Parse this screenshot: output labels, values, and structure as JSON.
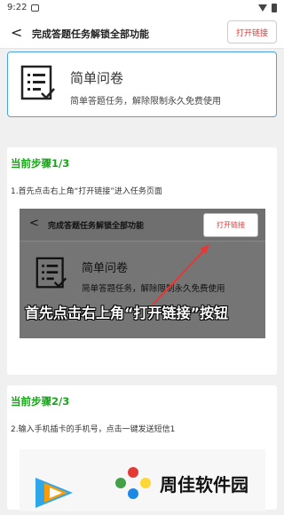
{
  "status_bar": {
    "time": "9:22"
  },
  "header": {
    "back_label": "<",
    "title": "完成答题任务解锁全部功能",
    "open_link_label": "打开链接"
  },
  "survey": {
    "name": "简单问卷",
    "description": "简单答题任务，解除限制永久免费使用"
  },
  "steps": [
    {
      "title": "当前步骤1/3",
      "text": "1.首先点击右上角“打开链接”进入任务页面",
      "image": {
        "back_label": "<",
        "title": "完成答题任务解锁全部功能",
        "open_link_label": "打开链接",
        "survey_name": "简单问卷",
        "survey_description": "简单答题任务，解除限制永久免费使用",
        "caption": "首先点击右上角“打开链接”按钮"
      }
    },
    {
      "title": "当前步骤2/3",
      "text": "2.输入手机插卡的手机号，点击一键发送短信1"
    }
  ],
  "watermark": {
    "text": "周佳软件园"
  },
  "colors": {
    "accent_red": "#e53935",
    "step_green": "#1aa31a",
    "card_border": "#4da3e0",
    "arrow_red": "#e53935"
  }
}
